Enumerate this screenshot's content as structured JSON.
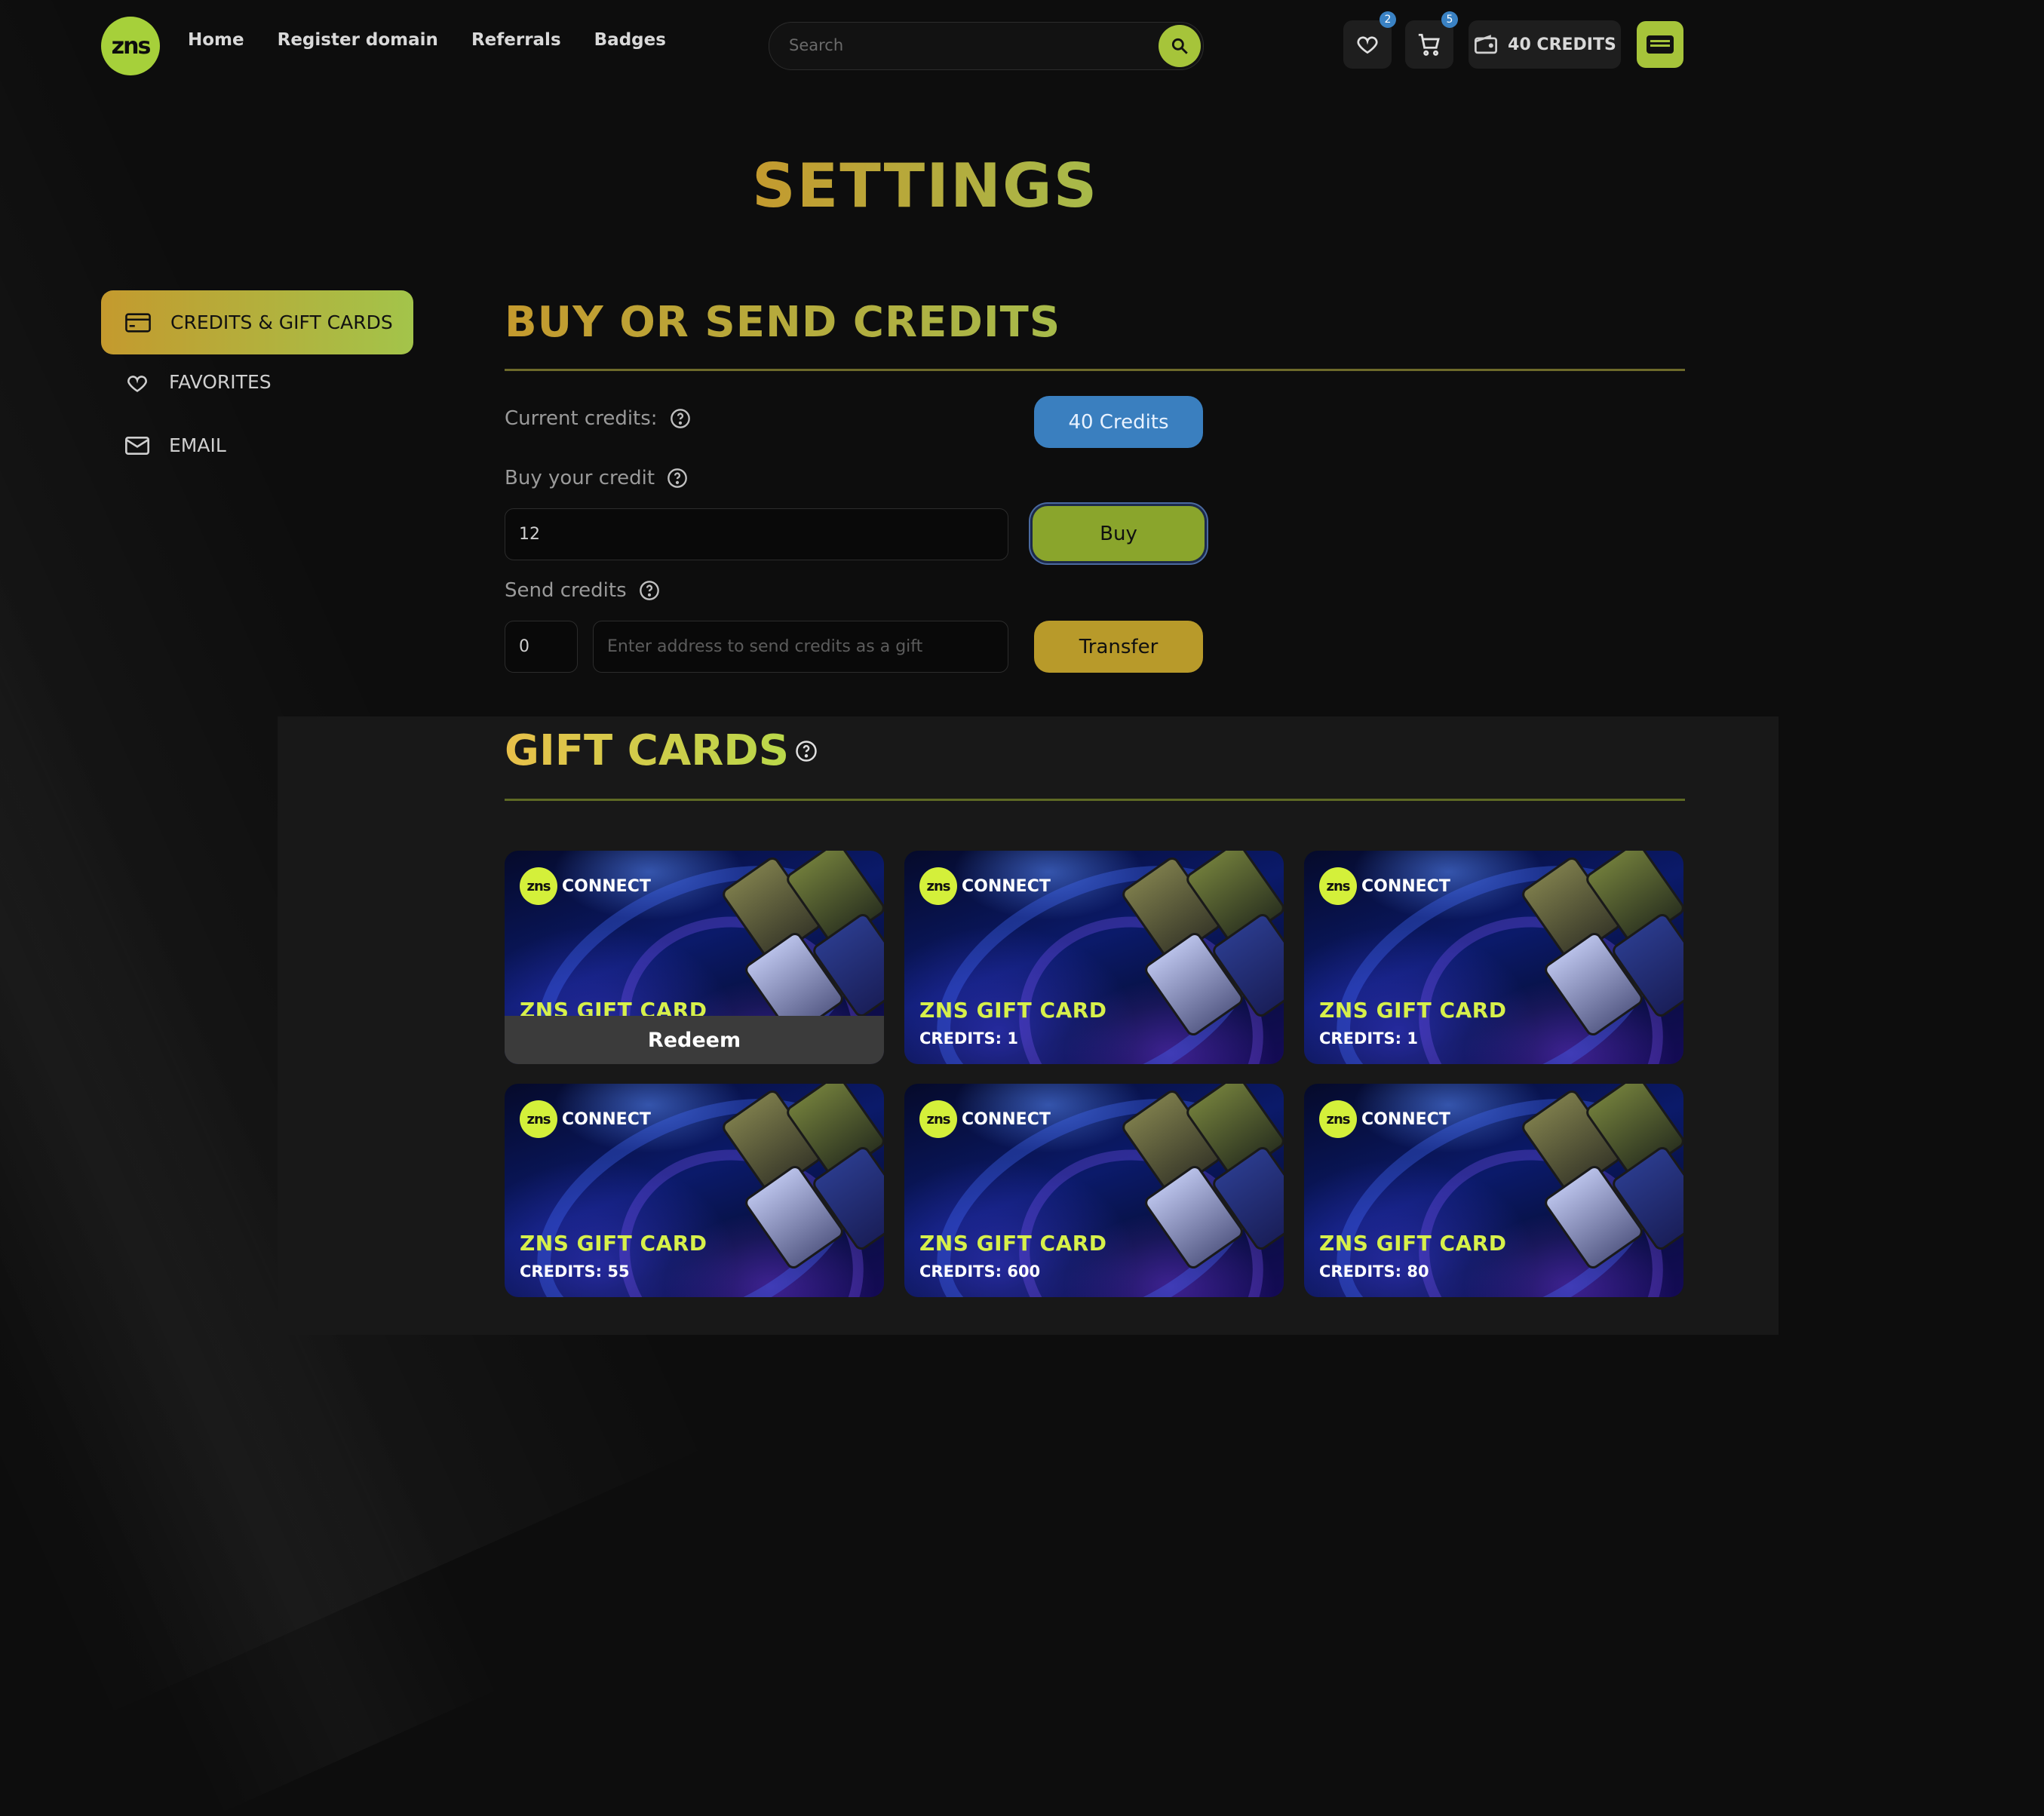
{
  "header": {
    "logo_text": "zns",
    "nav": [
      "Home",
      "Register domain",
      "Referrals",
      "Badges"
    ],
    "search_placeholder": "Search",
    "favorites_count": "2",
    "cart_count": "5",
    "credits_label": "40 CREDITS"
  },
  "page_title": "SETTINGS",
  "sidebar": {
    "items": [
      {
        "label": "CREDITS & GIFT CARDS",
        "icon": "credit-card-icon",
        "active": true
      },
      {
        "label": "FAVORITES",
        "icon": "heart-icon"
      },
      {
        "label": "EMAIL",
        "icon": "mail-icon"
      }
    ]
  },
  "credits_section": {
    "title": "BUY OR SEND CREDITS",
    "current_label": "Current credits:",
    "current_value": "40 Credits",
    "buy_label": "Buy your credit",
    "buy_value": "12",
    "buy_button": "Buy",
    "send_label": "Send credits",
    "send_amount": "0",
    "send_address_placeholder": "Enter address to send credits as a gift",
    "transfer_button": "Transfer"
  },
  "gift_section": {
    "title": "GIFT CARDS",
    "cards": [
      {
        "brand": "CONNECT",
        "title": "ZNS GIFT CARD",
        "credits": "",
        "action": "Redeem"
      },
      {
        "brand": "CONNECT",
        "title": "ZNS GIFT CARD",
        "credits": "CREDITS: 1",
        "action": ""
      },
      {
        "brand": "CONNECT",
        "title": "ZNS GIFT CARD",
        "credits": "CREDITS: 1",
        "action": ""
      },
      {
        "brand": "CONNECT",
        "title": "ZNS GIFT CARD",
        "credits": "CREDITS: 55",
        "action": ""
      },
      {
        "brand": "CONNECT",
        "title": "ZNS GIFT CARD",
        "credits": "CREDITS: 600",
        "action": ""
      },
      {
        "brand": "CONNECT",
        "title": "ZNS GIFT CARD",
        "credits": "CREDITS: 80",
        "action": ""
      }
    ]
  },
  "colors": {
    "accent_green": "#a6c43a",
    "accent_gold": "#c49a2e",
    "credits_blue": "#3a82c4",
    "transfer_gold": "#c4a02e"
  }
}
